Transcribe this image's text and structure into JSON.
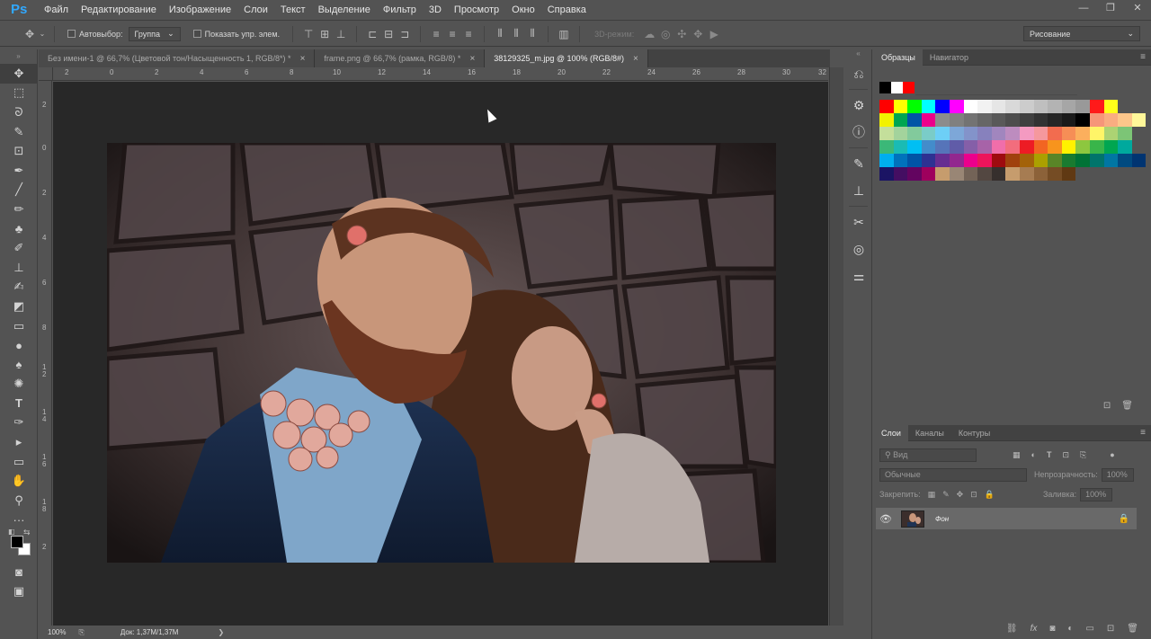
{
  "app": {
    "logo": "Ps"
  },
  "menu": [
    "Файл",
    "Редактирование",
    "Изображение",
    "Слои",
    "Текст",
    "Выделение",
    "Фильтр",
    "3D",
    "Просмотр",
    "Окно",
    "Справка"
  ],
  "window_controls": {
    "minimize": "—",
    "restore": "❐",
    "close": "✕"
  },
  "options": {
    "autoselect_label": "Автовыбор:",
    "autoselect_value": "Группа",
    "show_transform_label": "Показать упр. элем.",
    "mode_3d_label": "3D-режим:",
    "workspace": "Рисование"
  },
  "tabs": [
    {
      "title": "Без имени-1 @ 66,7% (Цветовой тон/Насыщенность 1, RGB/8*) *",
      "close": "×"
    },
    {
      "title": "frame.png @ 66,7% (рамка, RGB/8) *",
      "close": "×"
    },
    {
      "title": "38129325_m.jpg @ 100% (RGB/8#)",
      "close": "×",
      "active": true
    }
  ],
  "ruler": {
    "top_labels": [
      "2",
      "0",
      "2",
      "4",
      "6",
      "8",
      "10",
      "12",
      "14",
      "16",
      "18",
      "20",
      "22",
      "24",
      "26",
      "28",
      "30",
      "32"
    ],
    "left_labels": [
      "2",
      "0",
      "2",
      "4",
      "6",
      "8",
      "1",
      "2",
      "1",
      "4",
      "1",
      "6",
      "1",
      "8",
      "2"
    ]
  },
  "status": {
    "zoom": "100%",
    "doc": "Док: 1,37M/1,37M",
    "arrow": "❯"
  },
  "panels": {
    "swatches_tab": "Образцы",
    "navigator_tab": "Навигатор",
    "layers_tab": "Слои",
    "channels_tab": "Каналы",
    "paths_tab": "Контуры",
    "filter_placeholder": "Вид",
    "blend_mode": "Обычные",
    "opacity_label": "Непрозрачность:",
    "opacity_value": "100%",
    "lock_label": "Закрепить:",
    "fill_label": "Заливка:",
    "fill_value": "100%"
  },
  "layer": {
    "name": "Фон"
  },
  "swatches": {
    "row0": [
      "#000000",
      "#ffffff",
      "#ff0000"
    ],
    "row1": [
      "#ff0000",
      "#ffff00",
      "#00ff00",
      "#00ffff",
      "#0000ff",
      "#ff00ff",
      "#ffffff",
      "#f2f2f2",
      "#e6e6e6",
      "#d9d9d9",
      "#cccccc",
      "#bfbfbf",
      "#b3b3b3",
      "#a6a6a6",
      "#999999",
      "#ff1a1a",
      "#ffff1a"
    ],
    "row2": [
      "#f2f200",
      "#00a651",
      "#0054a6",
      "#ec008c",
      "#8c8c8c",
      "#808080",
      "#737373",
      "#666666",
      "#595959",
      "#4d4d4d",
      "#404040",
      "#333333",
      "#262626",
      "#1a1a1a",
      "#000000",
      "#f69679",
      "#f9ad81",
      "#fdc68a",
      "#fff799"
    ],
    "row3": [
      "#c4df9b",
      "#a3d39c",
      "#82ca9c",
      "#7accc8",
      "#6dcff6",
      "#7da7d8",
      "#8393ca",
      "#8781bd",
      "#a186be",
      "#bd8cbf",
      "#f49ac1",
      "#f5989d",
      "#f26c4f",
      "#f68e56",
      "#fbaf5d",
      "#fff568",
      "#acd373",
      "#7cc576"
    ],
    "row4": [
      "#3bb878",
      "#1abbb4",
      "#00bff3",
      "#438ccb",
      "#5674b9",
      "#605ca8",
      "#855fa8",
      "#a763a8",
      "#f06eaa",
      "#f26d7d",
      "#ed1c24",
      "#f26522",
      "#f7941d",
      "#fff200",
      "#8dc73f",
      "#39b54a",
      "#00a651",
      "#00a99d"
    ],
    "row5": [
      "#00aeef",
      "#0072bc",
      "#0054a6",
      "#2e3192",
      "#662d91",
      "#92278f",
      "#ec008c",
      "#ed145b",
      "#9e0b0f",
      "#a0410d",
      "#a36209",
      "#aba000",
      "#598527",
      "#197b30",
      "#007236",
      "#00746b",
      "#0076a3",
      "#004a80",
      "#003471"
    ],
    "row6": [
      "#1b1464",
      "#440e62",
      "#630460",
      "#9e005d",
      "#c69c6d",
      "#998675",
      "#736357",
      "#534741",
      "#362f2d",
      "#c69c6d",
      "#a67c52",
      "#8c6239",
      "#754c24",
      "#603913"
    ]
  }
}
